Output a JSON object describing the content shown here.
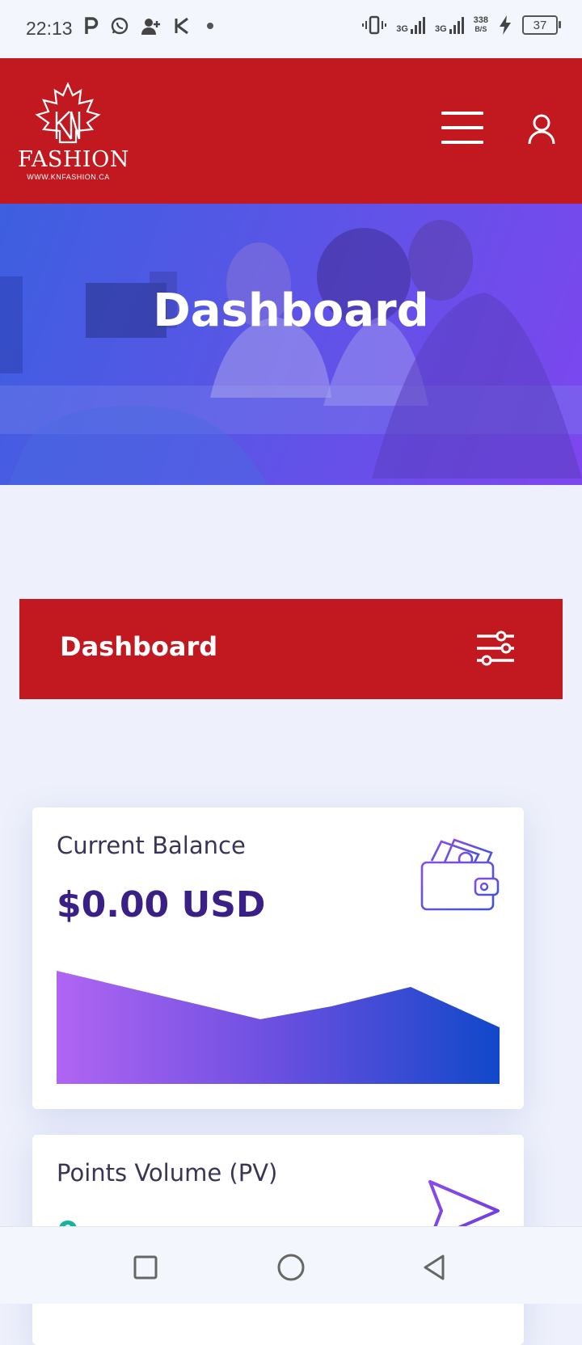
{
  "status_bar": {
    "time": "22:13",
    "net1": "3G",
    "net2": "3G",
    "speed_value": "338",
    "speed_unit": "B/S",
    "battery": "37"
  },
  "header": {
    "logo_text": "FASHION",
    "logo_url_text": "WWW.KNFASHION.CA",
    "brand_color": "#c21820"
  },
  "hero": {
    "title": "Dashboard"
  },
  "section": {
    "title": "Dashboard"
  },
  "cards": {
    "balance": {
      "label": "Current Balance",
      "value": "$0.00 USD"
    },
    "pv": {
      "label": "Points Volume (PV)",
      "value": "0"
    }
  },
  "icons": [
    "menu-icon",
    "user-icon",
    "filter-icon",
    "wallet-icon",
    "send-icon",
    "square-icon",
    "circle-icon",
    "back-icon"
  ]
}
